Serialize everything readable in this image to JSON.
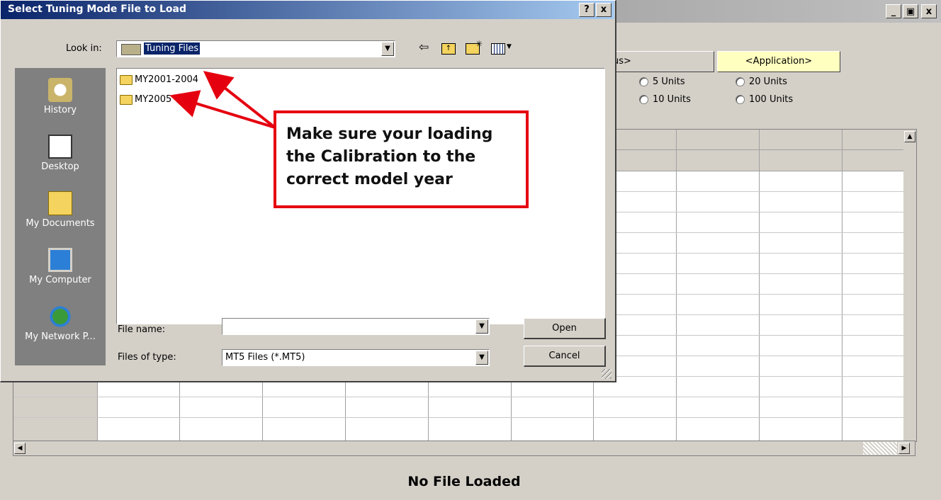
{
  "app": {
    "title_buttons": [
      "_",
      "ə",
      "x"
    ],
    "tabs": {
      "partial": "us>",
      "application": "<Application>"
    },
    "radios": [
      "5 Units",
      "10 Units",
      "20 Units",
      "100 Units"
    ],
    "status": "No File Loaded"
  },
  "dialog": {
    "title": "Select Tuning Mode File to Load",
    "help_btn": "?",
    "close_btn": "x",
    "look_in_label": "Look in:",
    "look_in_value": "Tuning Files",
    "places": [
      "History",
      "Desktop",
      "My Documents",
      "My Computer",
      "My Network P..."
    ],
    "files": [
      "MY2001-2004",
      "MY2005"
    ],
    "file_name_label": "File name:",
    "file_name_value": "",
    "files_of_type_label": "Files of type:",
    "files_of_type_value": "MT5 Files (*.MT5)",
    "open_label": "Open",
    "cancel_label": "Cancel"
  },
  "annotation": {
    "line1": "Make sure your loading",
    "line2": "the Calibration to the",
    "line3": "correct model year",
    "color": "#e5000f"
  },
  "colors": {
    "dialog_title": "#0a246a",
    "callout": "#e5000f",
    "tab_highlight": "#ffffc0"
  }
}
